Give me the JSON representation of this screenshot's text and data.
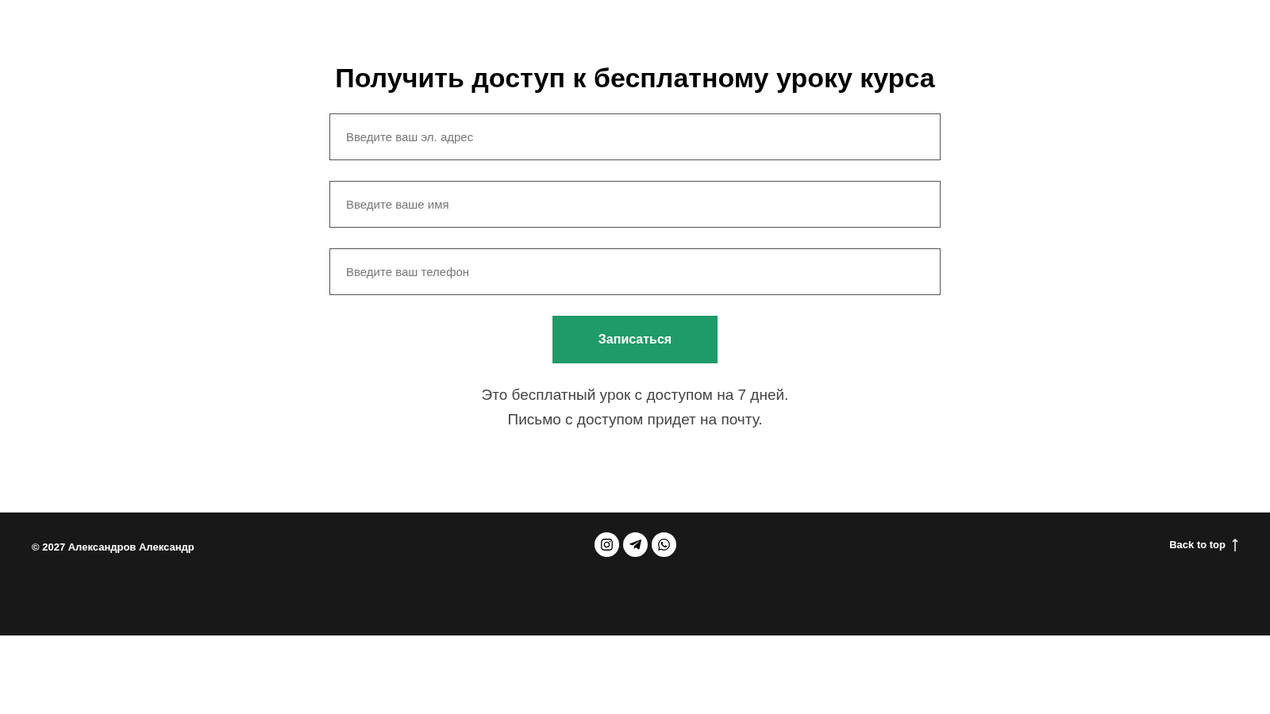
{
  "form": {
    "title": "Получить доступ к бесплатному уроку курса",
    "fields": [
      {
        "placeholder": "Введите ваш эл. адрес"
      },
      {
        "placeholder": "Введите ваше имя"
      },
      {
        "placeholder": "Введите ваш телефон"
      }
    ],
    "submit": "Записаться",
    "notes": [
      "Это бесплатный урок с доступом на 7 дней.",
      "Письмо с доступом придет на почту."
    ]
  },
  "footer": {
    "copyright": "© 2027 Александров Александр",
    "social": [
      {
        "kind": "instagram"
      },
      {
        "kind": "telegram"
      },
      {
        "kind": "whatsapp"
      }
    ],
    "back_to_top": "Back to top"
  }
}
